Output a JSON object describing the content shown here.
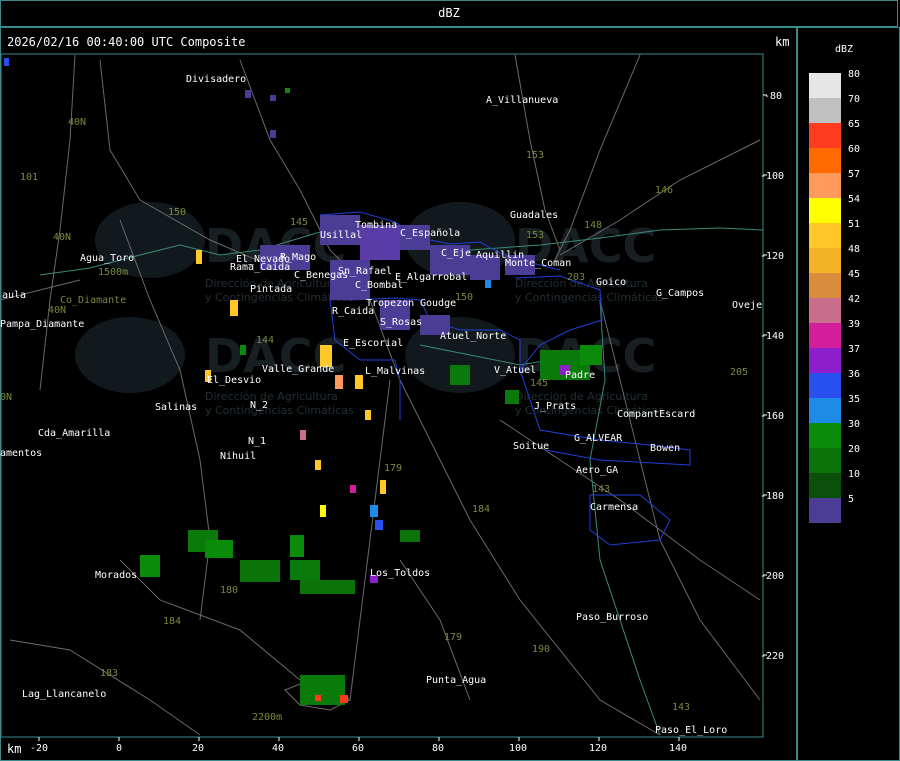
{
  "header": {
    "title": "dBZ"
  },
  "map": {
    "timestamp": "2026/02/16 00:40:00 UTC Composite",
    "unit_top": "km",
    "unit_bottom": "km",
    "x_ticks": [
      "-20",
      "0",
      "20",
      "40",
      "60",
      "80",
      "100",
      "120",
      "140"
    ],
    "y_ticks": [
      "-80",
      "-100",
      "-120",
      "-140",
      "-160",
      "-180",
      "-200",
      "-220"
    ],
    "watermark": {
      "logo_text": "DACC",
      "line1": "Dirección de Agricultura",
      "line2": "y Contingencias Climáticas"
    },
    "places": [
      "Divisadero",
      "A_Villanueva",
      "Guadales",
      "Usillal",
      "Tombina",
      "C_Española",
      "C_Eje",
      "Aquillin",
      "Monte_Coman",
      "Goico",
      "G_Campos",
      "Oveje",
      "Agua_Toro",
      "Rama_Caida",
      "Sn_Rafael",
      "C_Benegas",
      "Pintada",
      "El_Nevado",
      "R_Mago",
      "E_Algarrobal",
      "C_Bombal",
      "Tropezon",
      "Goudge",
      "R_Caida",
      "S_Rosas",
      "E_Escorial",
      "Atuel_Norte",
      "V_Atuel",
      "Padre",
      "J_Prats",
      "CompantEscard",
      "G_ALVEAR",
      "Bowen",
      "Soitue",
      "Aero_GA",
      "Carmensa",
      "Valle_Grande",
      "El_Desvio",
      "L_Malvinas",
      "Salinas",
      "N_2",
      "N_1",
      "Nihuil",
      "Cda_Amarilla",
      "Pampa_Diamante",
      "aula",
      "amentos",
      "Morados",
      "Los_Toldos",
      "Paso_Burroso",
      "Punta_Agua",
      "Lag_Llancanelo",
      "Paso_El_Loro",
      "1500m",
      "2200m",
      "Co_Diamante"
    ],
    "route_numbers": [
      "40N",
      "40N",
      "101",
      "150",
      "153",
      "153",
      "146",
      "148",
      "203",
      "144",
      "179",
      "184",
      "180",
      "184",
      "183",
      "179",
      "190",
      "143",
      "143",
      "205",
      "0N",
      "40N",
      "145",
      "150",
      "145"
    ]
  },
  "legend": {
    "title": "dBZ",
    "entries": [
      {
        "label": "80",
        "color": "#e6e6e6"
      },
      {
        "label": "70",
        "color": "#c0c0c0"
      },
      {
        "label": "65",
        "color": "#ff3b1f"
      },
      {
        "label": "60",
        "color": "#ff6a00"
      },
      {
        "label": "57",
        "color": "#ff9a5c"
      },
      {
        "label": "54",
        "color": "#ffff00"
      },
      {
        "label": "51",
        "color": "#ffc828"
      },
      {
        "label": "48",
        "color": "#f5b428"
      },
      {
        "label": "45",
        "color": "#d98c3c"
      },
      {
        "label": "42",
        "color": "#c86e8c"
      },
      {
        "label": "39",
        "color": "#d21e9b"
      },
      {
        "label": "37",
        "color": "#8c1ecc"
      },
      {
        "label": "36",
        "color": "#2850f0"
      },
      {
        "label": "35",
        "color": "#1e8ce6"
      },
      {
        "label": "30",
        "color": "#0a8c0a"
      },
      {
        "label": "20",
        "color": "#0a730a"
      },
      {
        "label": "10",
        "color": "#0a500a"
      },
      {
        "label": "5",
        "color": "#4b3c96"
      }
    ]
  }
}
